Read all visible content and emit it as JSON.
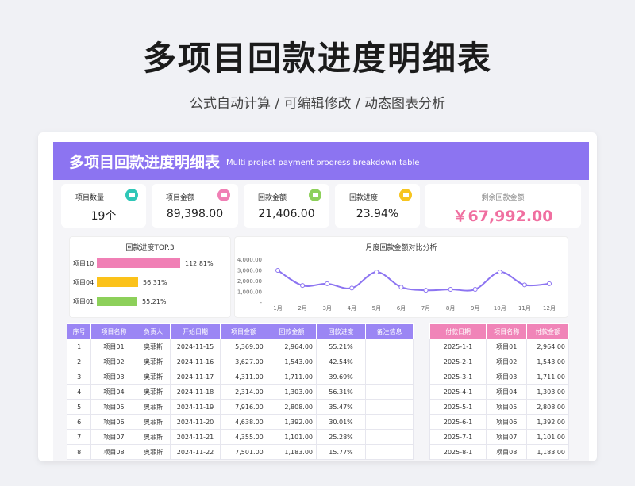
{
  "page": {
    "title": "多项目回款进度明细表",
    "subtitle": "公式自动计算 / 可编辑修改 / 动态图表分析"
  },
  "header": {
    "title": "多项目回款进度明细表",
    "subtitle": "Multi project payment progress breakdown table"
  },
  "kpis": [
    {
      "label": "项目数量",
      "value": "19个",
      "icon": "square-icon",
      "color": "#2fc7b7"
    },
    {
      "label": "项目金额",
      "value": "89,398.00",
      "icon": "square-icon",
      "color": "#f07fb5"
    },
    {
      "label": "回款金额",
      "value": "21,406.00",
      "icon": "square-icon",
      "color": "#8dd05a"
    },
    {
      "label": "回款进度",
      "value": "23.94%",
      "icon": "square-icon",
      "color": "#f7c520"
    }
  ],
  "remaining": {
    "label": "剩余回款金额",
    "value": "￥67,992.00"
  },
  "top3": {
    "title": "回款进度TOP.3",
    "items": [
      {
        "label": "项目10",
        "value": "112.81%",
        "pct": 112.81,
        "color": "#f07fb5"
      },
      {
        "label": "项目04",
        "value": "56.31%",
        "pct": 56.31,
        "color": "#fbc21a"
      },
      {
        "label": "项目01",
        "value": "55.21%",
        "pct": 55.21,
        "color": "#8dd05a"
      }
    ]
  },
  "chart_data": {
    "type": "line",
    "title": "月度回款金额对比分析",
    "categories": [
      "1月",
      "2月",
      "3月",
      "4月",
      "5月",
      "6月",
      "7月",
      "8月",
      "9月",
      "10月",
      "11月",
      "12月"
    ],
    "values": [
      2964,
      1543,
      1711,
      1303,
      2808,
      1392,
      1101,
      1183,
      1183,
      2808,
      1600,
      1711
    ],
    "y_ticks": [
      "4,000.00",
      "3,000.00",
      "2,000.00",
      "1,000.00",
      "-"
    ],
    "ylim": [
      0,
      4000
    ],
    "color": "#8c74f1"
  },
  "main_table": {
    "headers": [
      "序号",
      "项目名称",
      "负责人",
      "开始日期",
      "项目金额",
      "回款金额",
      "回款进度",
      "备注信息"
    ],
    "rows": [
      [
        "1",
        "项目01",
        "奥菲斯",
        "2024-11-15",
        "5,369.00",
        "2,964.00",
        "55.21%",
        ""
      ],
      [
        "2",
        "项目02",
        "奥菲斯",
        "2024-11-16",
        "3,627.00",
        "1,543.00",
        "42.54%",
        ""
      ],
      [
        "3",
        "项目03",
        "奥菲斯",
        "2024-11-17",
        "4,311.00",
        "1,711.00",
        "39.69%",
        ""
      ],
      [
        "4",
        "项目04",
        "奥菲斯",
        "2024-11-18",
        "2,314.00",
        "1,303.00",
        "56.31%",
        ""
      ],
      [
        "5",
        "项目05",
        "奥菲斯",
        "2024-11-19",
        "7,916.00",
        "2,808.00",
        "35.47%",
        ""
      ],
      [
        "6",
        "项目06",
        "奥菲斯",
        "2024-11-20",
        "4,638.00",
        "1,392.00",
        "30.01%",
        ""
      ],
      [
        "7",
        "项目07",
        "奥菲斯",
        "2024-11-21",
        "4,355.00",
        "1,101.00",
        "25.28%",
        ""
      ],
      [
        "8",
        "项目08",
        "奥菲斯",
        "2024-11-22",
        "7,501.00",
        "1,183.00",
        "15.77%",
        ""
      ]
    ]
  },
  "pay_table": {
    "headers": [
      "付款日期",
      "项目名称",
      "付款金额"
    ],
    "rows": [
      [
        "2025-1-1",
        "项目01",
        "2,964.00"
      ],
      [
        "2025-2-1",
        "项目02",
        "1,543.00"
      ],
      [
        "2025-3-1",
        "项目03",
        "1,711.00"
      ],
      [
        "2025-4-1",
        "项目04",
        "1,303.00"
      ],
      [
        "2025-5-1",
        "项目05",
        "2,808.00"
      ],
      [
        "2025-6-1",
        "项目06",
        "1,392.00"
      ],
      [
        "2025-7-1",
        "项目07",
        "1,101.00"
      ],
      [
        "2025-8-1",
        "项目08",
        "1,183.00"
      ]
    ]
  },
  "colors": {
    "accent": "#8c74f1",
    "pink": "#f07fb5",
    "main_header": "#9b86f4",
    "pay_header": "#f084b8"
  }
}
